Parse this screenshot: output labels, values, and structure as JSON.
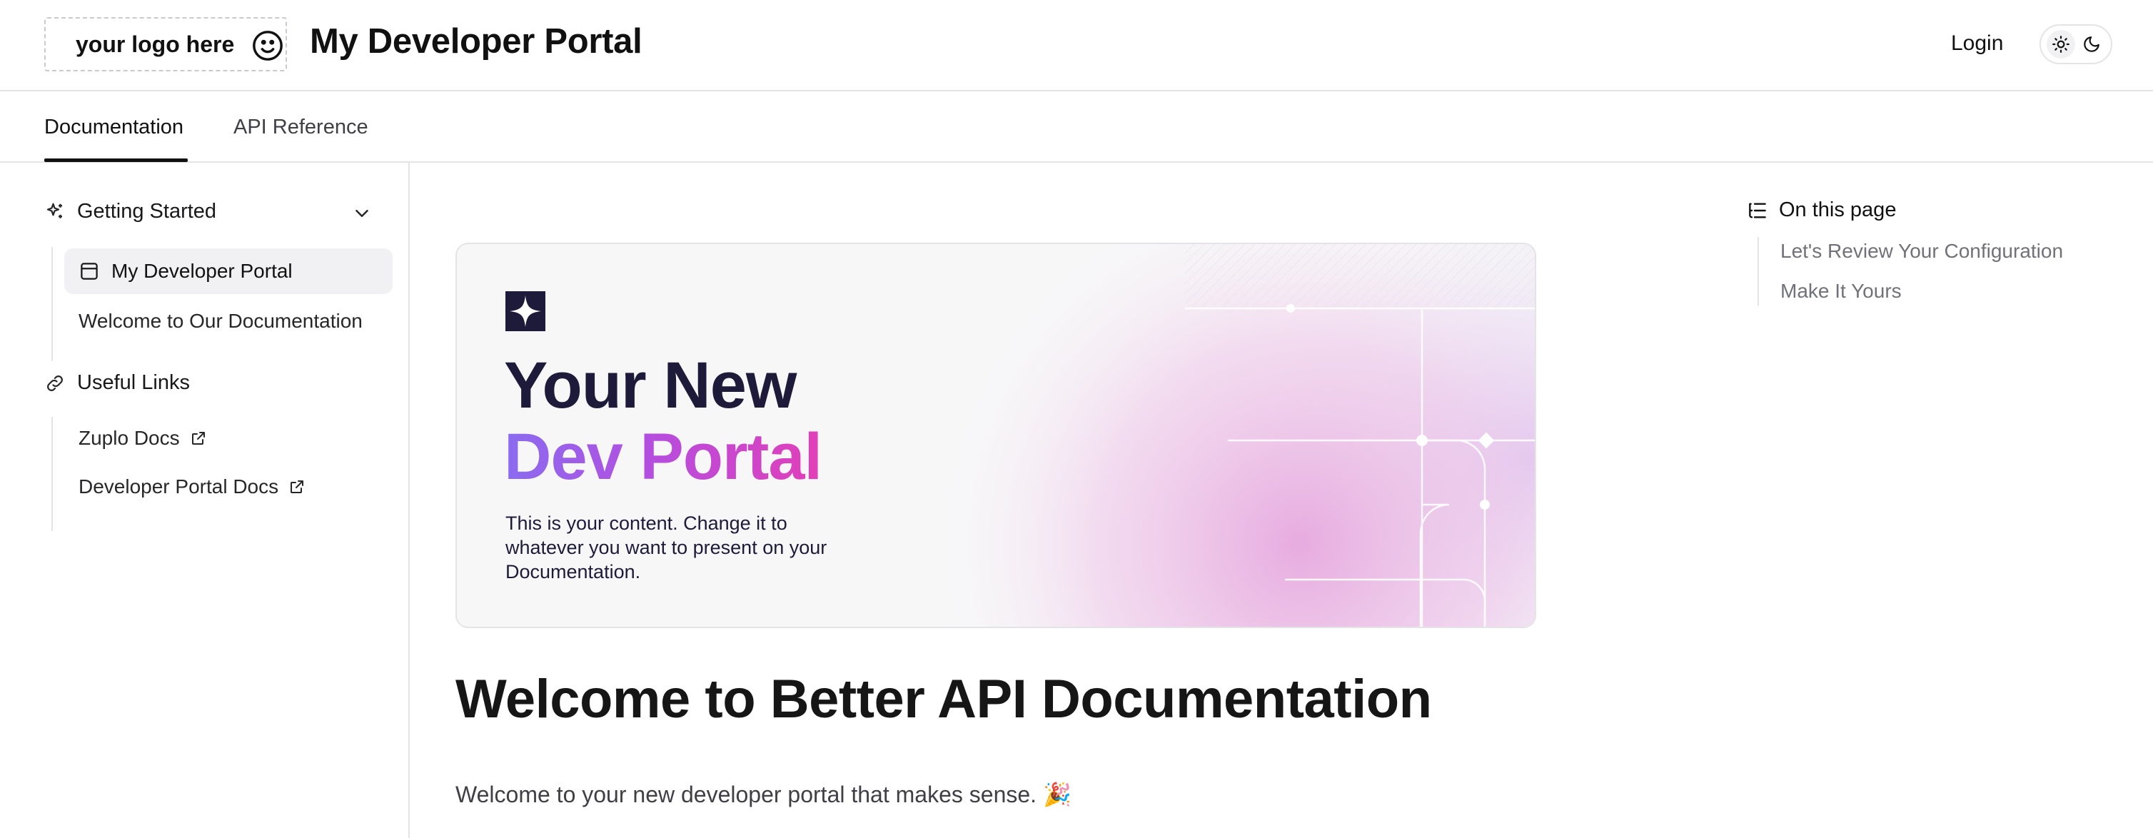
{
  "header": {
    "logo_text": "your logo here",
    "title": "My Developer Portal",
    "login_label": "Login",
    "theme_toggle": {
      "light_icon": "sun-icon",
      "dark_icon": "moon-icon",
      "active": "light"
    }
  },
  "tabs": [
    {
      "label": "Documentation",
      "active": true
    },
    {
      "label": "API Reference",
      "active": false
    }
  ],
  "sidebar": {
    "groups": [
      {
        "title": "Getting Started",
        "icon": "sparkles-icon",
        "expanded": true,
        "items": [
          {
            "label": "My Developer Portal",
            "icon": "layout-icon",
            "active": true
          },
          {
            "label": "Welcome to Our Documentation",
            "active": false
          }
        ]
      },
      {
        "title": "Useful Links",
        "icon": "link-icon",
        "items": [
          {
            "label": "Zuplo Docs",
            "external": true
          },
          {
            "label": "Developer Portal Docs",
            "external": true
          }
        ]
      }
    ]
  },
  "hero": {
    "line1": "Your New",
    "line2": "Dev Portal",
    "body": "This is your content. Change it to whatever you want to present on your Documentation."
  },
  "main": {
    "heading": "Welcome to Better API Documentation",
    "intro": "Welcome to your new developer portal that makes sense. 🎉"
  },
  "toc": {
    "title": "On this page",
    "items": [
      {
        "label": "Let's Review Your Configuration"
      },
      {
        "label": "Make It Yours"
      }
    ]
  },
  "colors": {
    "accent_gradient_start": "#8a6cf0",
    "accent_gradient_end": "#e23fb8",
    "border": "#e4e4e7",
    "muted_text": "#71717a"
  }
}
